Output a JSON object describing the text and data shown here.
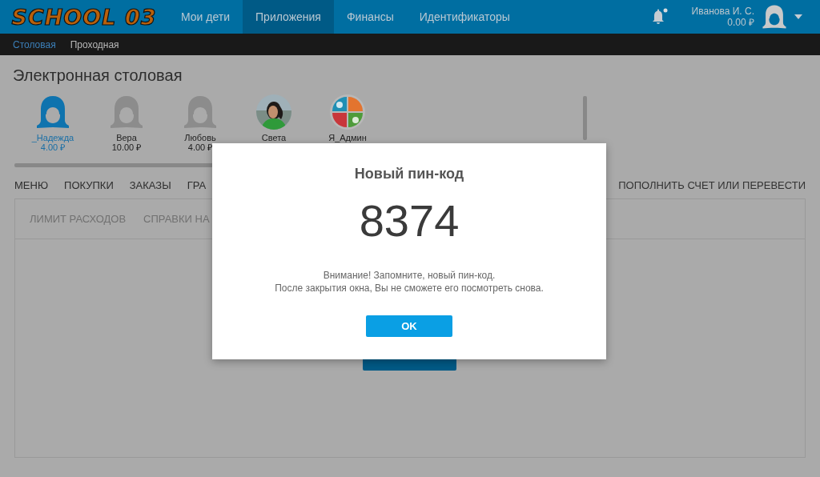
{
  "header": {
    "logo": "SCHOOL 03",
    "nav": [
      {
        "label": "Мои дети",
        "selected": false
      },
      {
        "label": "Приложения",
        "selected": true
      },
      {
        "label": "Финансы",
        "selected": false
      },
      {
        "label": "Идентификаторы",
        "selected": false
      }
    ],
    "notifications": {
      "unread": true
    },
    "user": {
      "name": "Иванова И. С.",
      "balance": "0.00 ₽"
    }
  },
  "subnav": [
    {
      "label": "Столовая",
      "selected": true
    },
    {
      "label": "Проходная",
      "selected": false
    }
  ],
  "page_title": "Электронная столовая",
  "people": [
    {
      "name": "_Надежда",
      "balance": "4.00 ₽",
      "selected": true,
      "kind": "female"
    },
    {
      "name": "Вера",
      "balance": "10.00 ₽",
      "selected": false,
      "kind": "female"
    },
    {
      "name": "Любовь",
      "balance": "4.00 ₽",
      "selected": false,
      "kind": "female"
    },
    {
      "name": "Света",
      "selected": false,
      "kind": "picture"
    },
    {
      "name": "Я_Админ",
      "selected": false,
      "kind": "admin"
    }
  ],
  "tabs": [
    {
      "label": "МЕНЮ"
    },
    {
      "label": "ПОКУПКИ"
    },
    {
      "label": "ЗАКАЗЫ"
    },
    {
      "label": "ГРА"
    }
  ],
  "top_up_link": "ПОПОЛНИТЬ СЧЕТ ИЛИ ПЕРЕВЕСТИ",
  "subtabs": [
    {
      "label": "ЛИМИТ РАСХОДОВ"
    },
    {
      "label": "СПРАВКИ НА"
    }
  ],
  "dialog": {
    "title": "Новый пин-код",
    "pin": "8374",
    "message": [
      "Внимание! Запомните, новый пин-код.",
      "После закрытия окна, Вы не сможете его посмотреть снова."
    ],
    "button": "OK"
  }
}
